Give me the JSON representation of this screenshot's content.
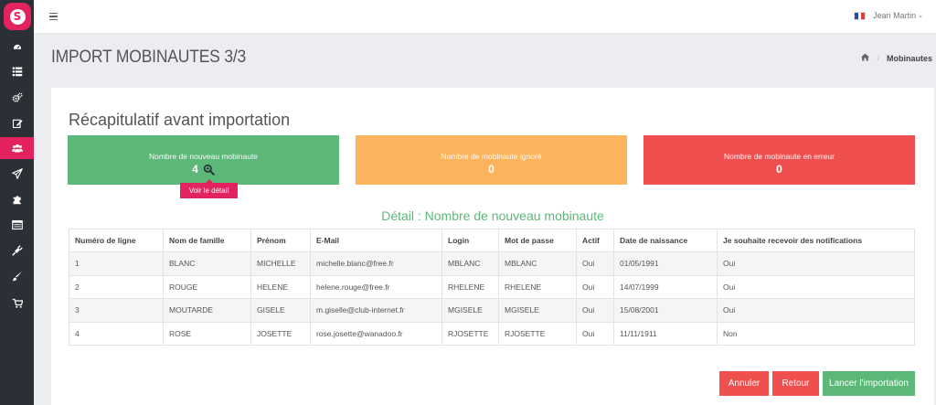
{
  "brand": {
    "letter": "S",
    "color": "#e2235f"
  },
  "sidebar": {
    "items": [
      {
        "icon": "dashboard-icon"
      },
      {
        "icon": "list-icon"
      },
      {
        "icon": "cogs-icon"
      },
      {
        "icon": "edit-icon"
      },
      {
        "icon": "users-icon",
        "active": true
      },
      {
        "icon": "send-icon"
      },
      {
        "icon": "puzzle-icon"
      },
      {
        "icon": "window-icon"
      },
      {
        "icon": "plug-icon"
      },
      {
        "icon": "brush-icon"
      },
      {
        "icon": "cart-icon"
      }
    ]
  },
  "topbar": {
    "user_name": "Jean Martin",
    "caret": "⌄",
    "flag": "france-flag"
  },
  "header": {
    "title": "IMPORT MOBINAUTES 3/3",
    "breadcrumb_sep": "/",
    "breadcrumb_current": "Mobinautes"
  },
  "panel": {
    "title": "Récapitulatif avant importation",
    "stats": {
      "new": {
        "label": "Nombre de nouveau mobinaute",
        "value": "4",
        "color": "#5cb878"
      },
      "ignored": {
        "label": "Nombre de mobinaute ignoré",
        "value": "0",
        "color": "#fbb45c"
      },
      "error": {
        "label": "Nombre de mobinaute en erreur",
        "value": "0",
        "color": "#ef4f4f"
      }
    },
    "tooltip": "Voir le détail",
    "detail_title": "Détail : Nombre de nouveau mobinaute",
    "table": {
      "headers": [
        "Numéro de ligne",
        "Nom de famille",
        "Prénom",
        "E-Mail",
        "Login",
        "Mot de passe",
        "Actif",
        "Date de naissance",
        "Je souhaite recevoir des notifications"
      ],
      "rows": [
        [
          "1",
          "BLANC",
          "MICHELLE",
          "michelle.blanc@free.fr",
          "MBLANC",
          "MBLANC",
          "Oui",
          "01/05/1991",
          "Oui"
        ],
        [
          "2",
          "ROUGE",
          "HELENE",
          "helene.rouge@free.fr",
          "RHELENE",
          "RHELENE",
          "Oui",
          "14/07/1999",
          "Oui"
        ],
        [
          "3",
          "MOUTARDE",
          "GISELE",
          "m.giselle@club-internet.fr",
          "MGISELE",
          "MGISELE",
          "Oui",
          "15/08/2001",
          "Oui"
        ],
        [
          "4",
          "ROSE",
          "JOSETTE",
          "rose.josette@wanadoo.fr",
          "RJOSETTE",
          "RJOSETTE",
          "Oui",
          "11/11/1911",
          "Non"
        ]
      ]
    },
    "buttons": {
      "cancel": "Annuler",
      "back": "Retour",
      "launch": "Lancer l'importation"
    }
  },
  "colors": {
    "accent": "#e2235f",
    "success": "#5cb878",
    "warning": "#fbb45c",
    "danger": "#ef4f4f",
    "sidebar": "#2b2f36"
  }
}
